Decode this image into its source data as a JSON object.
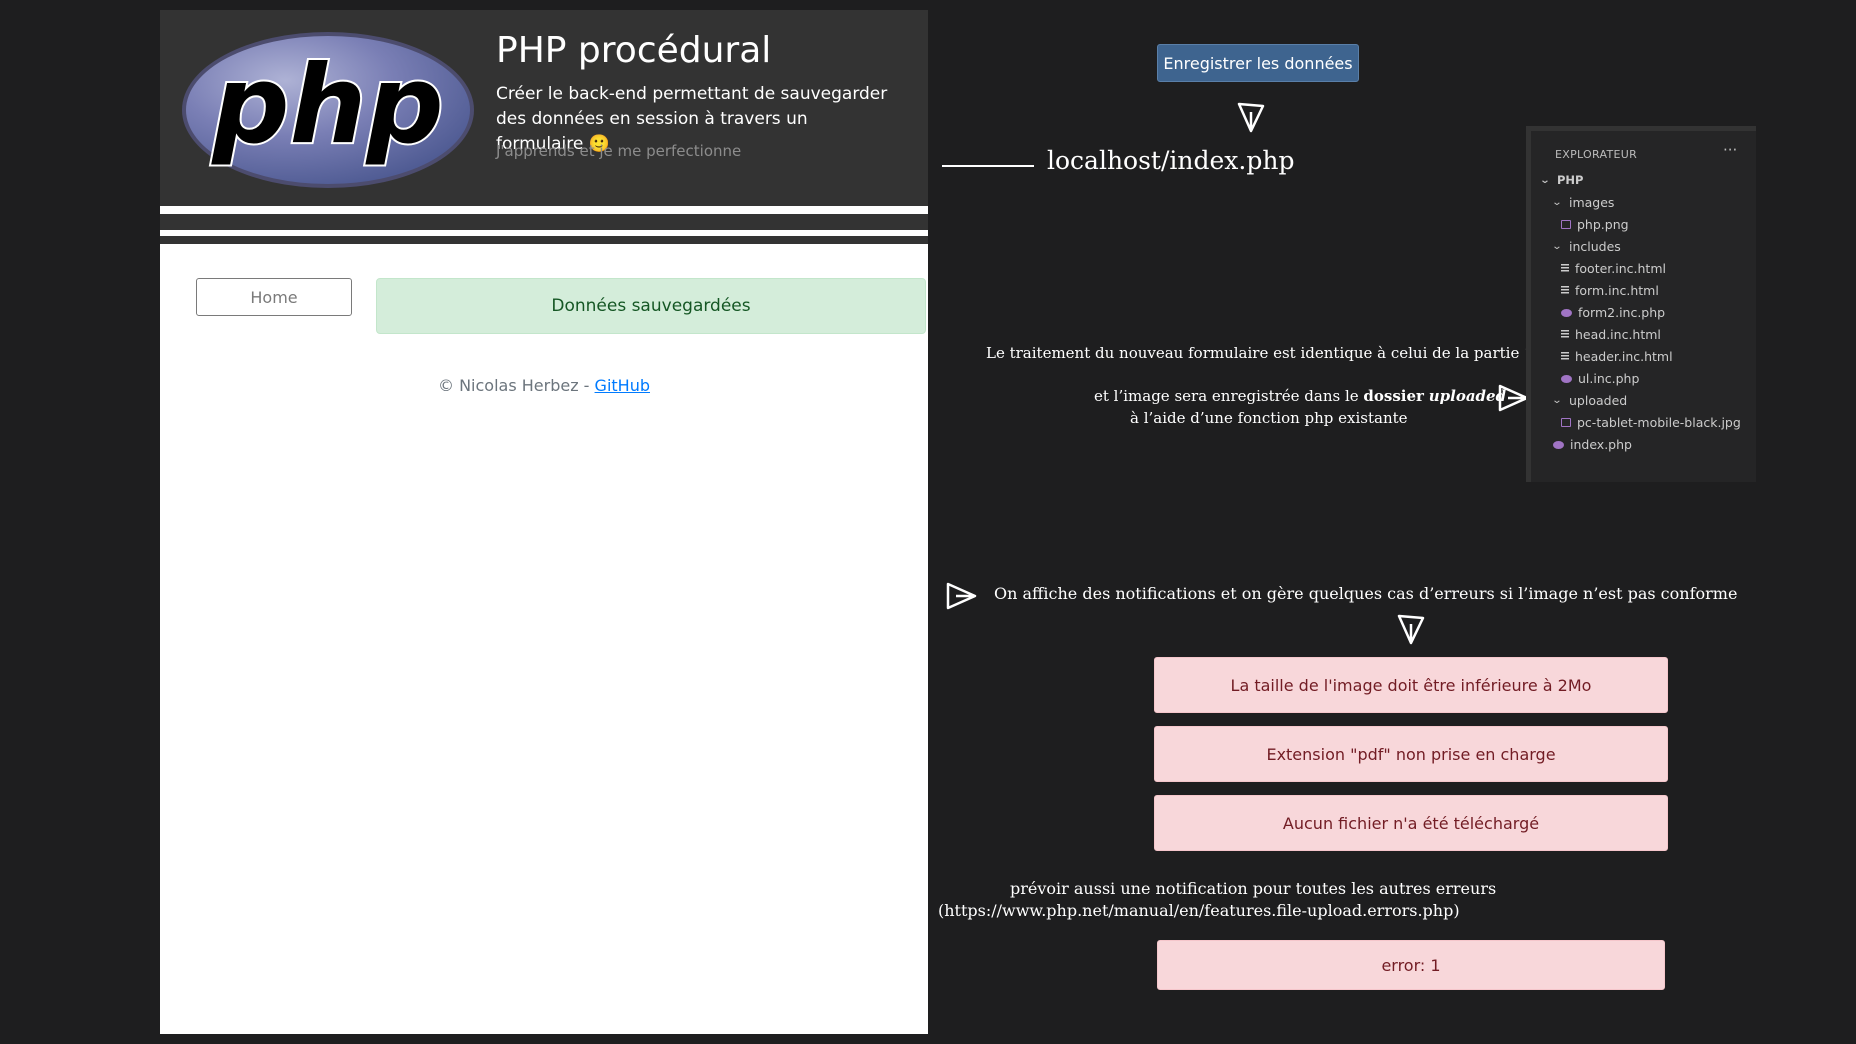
{
  "hero": {
    "title": "PHP procédural",
    "lead": "Créer le back-end permettant de sauvegarder des données en session à travers un formulaire 🙂",
    "muted": "J'apprends et je me perfectionne",
    "logo_text": "php"
  },
  "nav": {
    "home_label": "Home"
  },
  "alert_success": "Données sauvegardées",
  "footer": {
    "copyright": "© Nicolas Herbez - ",
    "link": "GitHub"
  },
  "annotations": {
    "save_button": "Enregistrer les données",
    "url": "localhost/index.php",
    "note_line1": "Le traitement du nouveau formulaire est identique à celui de la partie 1",
    "note_line2_a": "et l’image sera enregistrée dans le ",
    "note_line2_b": "dossier",
    "note_line2_c": "uploaded",
    "note_line3": "à l’aide d’une fonction php existante",
    "note_errors": "On affiche des notifications et on gère quelques cas d’erreurs si l’image n’est pas conforme",
    "note_other_1": "prévoir aussi une notification pour toutes les autres erreurs",
    "note_other_2": "(https://www.php.net/manual/en/features.file-upload.errors.php)"
  },
  "errors": [
    "La taille de l'image doit être inférieure à 2Mo",
    "Extension \"pdf\" non prise en charge",
    "Aucun fichier n'a été téléchargé",
    "error: 1"
  ],
  "explorer": {
    "title": "EXPLORATEUR",
    "more": "···",
    "root": "PHP",
    "items": [
      {
        "label": "images",
        "kind": "folder"
      },
      {
        "label": "php.png",
        "kind": "image"
      },
      {
        "label": "includes",
        "kind": "folder"
      },
      {
        "label": "footer.inc.html",
        "kind": "text"
      },
      {
        "label": "form.inc.html",
        "kind": "text"
      },
      {
        "label": "form2.inc.php",
        "kind": "php"
      },
      {
        "label": "head.inc.html",
        "kind": "text"
      },
      {
        "label": "header.inc.html",
        "kind": "text"
      },
      {
        "label": "ul.inc.php",
        "kind": "php"
      },
      {
        "label": "uploaded",
        "kind": "folder"
      },
      {
        "label": "pc-tablet-mobile-black.jpg",
        "kind": "image"
      },
      {
        "label": "index.php",
        "kind": "php"
      }
    ]
  },
  "colors": {
    "php_logo": "#7a7fb5",
    "success_bg": "#d4edda",
    "error_bg": "#f8d7da",
    "button_blue": "#3e648f"
  }
}
